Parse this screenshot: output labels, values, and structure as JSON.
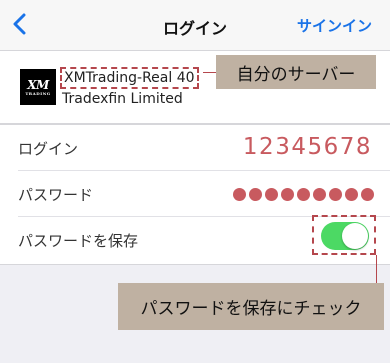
{
  "nav": {
    "back_icon": "chevron-left-icon",
    "title": "ログイン",
    "action_label": "サインイン",
    "accent_color": "#1a73e8"
  },
  "server": {
    "logo_mark": "XM",
    "logo_sub": "TRADING",
    "name": "XMTrading-Real 40",
    "company": "Tradexfin Limited"
  },
  "form": {
    "login_label": "ログイン",
    "login_value": "12345678",
    "password_label": "パスワード",
    "password_dot_count": 9,
    "save_password_label": "パスワードを保存",
    "save_password_on": true
  },
  "annotations": {
    "server_callout": "自分のサーバー",
    "save_callout": "パスワードを保存にチェック",
    "callout_color": "#bfb1a2",
    "highlight_color": "#b5474d"
  },
  "colors": {
    "value_red": "#c85a5f",
    "toggle_on": "#4cd964",
    "background": "#efeff4"
  }
}
